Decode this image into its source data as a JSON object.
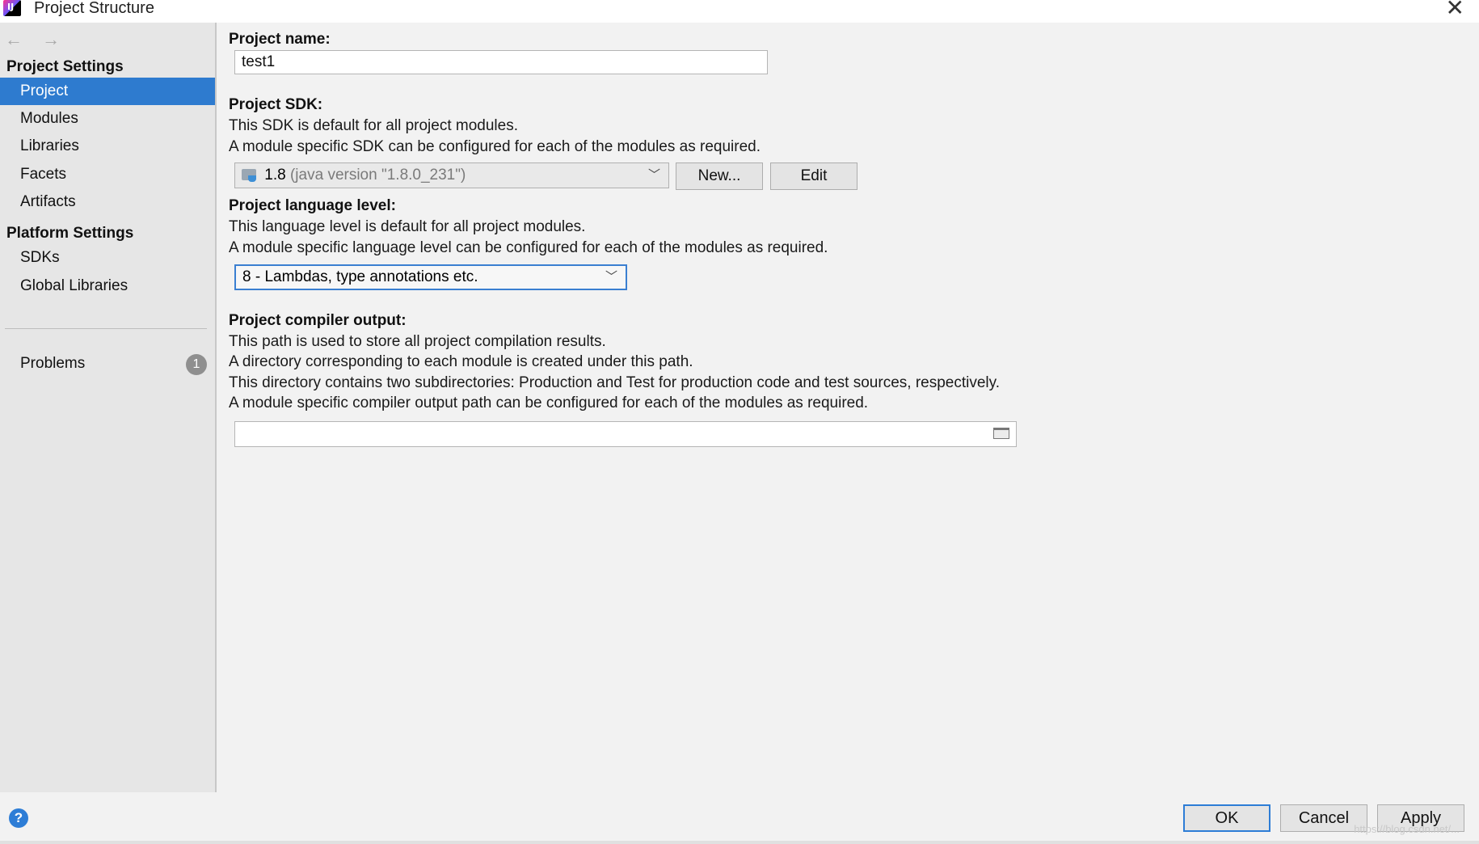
{
  "window": {
    "title": "Project Structure",
    "close_icon": "close-icon"
  },
  "sidebar": {
    "back_icon": "←",
    "forward_icon": "→",
    "project_settings_header": "Project Settings",
    "project_settings_items": [
      {
        "label": "Project",
        "selected": true
      },
      {
        "label": "Modules"
      },
      {
        "label": "Libraries"
      },
      {
        "label": "Facets"
      },
      {
        "label": "Artifacts"
      }
    ],
    "platform_settings_header": "Platform Settings",
    "platform_settings_items": [
      {
        "label": "SDKs"
      },
      {
        "label": "Global Libraries"
      }
    ],
    "problems_label": "Problems",
    "problems_count": "1",
    "selected_color": "#2e7bcf"
  },
  "main": {
    "project_name": {
      "label": "Project name:",
      "value": "test1"
    },
    "project_sdk": {
      "label": "Project SDK:",
      "desc1": "This SDK is default for all project modules.",
      "desc2": "A module specific SDK can be configured for each of the modules as required.",
      "selected_version": "1.8",
      "selected_detail": "(java version \"1.8.0_231\")",
      "new_button": "New...",
      "edit_button": "Edit"
    },
    "language_level": {
      "label": "Project language level:",
      "desc1": "This language level is default for all project modules.",
      "desc2": "A module specific language level can be configured for each of the modules as required.",
      "selected": "8 - Lambdas, type annotations etc."
    },
    "compiler_output": {
      "label": "Project compiler output:",
      "desc1": "This path is used to store all project compilation results.",
      "desc2": "A directory corresponding to each module is created under this path.",
      "desc3": "This directory contains two subdirectories: Production and Test for production code and test sources, respectively.",
      "desc4": "A module specific compiler output path can be configured for each of the modules as required.",
      "value": ""
    }
  },
  "footer": {
    "help": "?",
    "ok_button": "OK",
    "cancel_button": "Cancel",
    "apply_button": "Apply",
    "watermark": "https://blog.csdn.net/..."
  }
}
